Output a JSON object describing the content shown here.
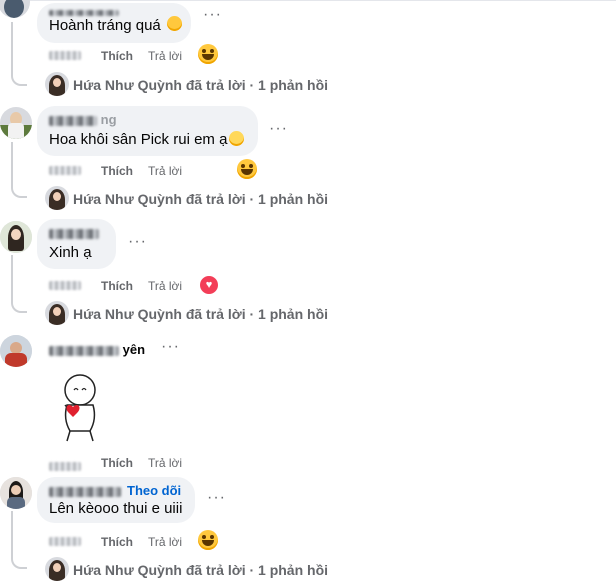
{
  "comments": [
    {
      "text": "Hoành tráng quá",
      "emoji": "🥺",
      "reply_label": "Trả lời",
      "like_label": "Thích"
    },
    {
      "name_suffix": "ng",
      "text": "Hoa khôi sân Pick rui em ạ",
      "emoji": "😬",
      "reply_label": "Trả lời",
      "like_label": "Thích"
    },
    {
      "text": "Xinh ạ",
      "reply_label": "Trả lời",
      "like_label": "Thích"
    },
    {
      "name_suffix": "yên",
      "reply_label": "Trả lời",
      "like_label": "Thích"
    },
    {
      "follow_label": "Theo dõi",
      "text": "Lên kèooo thui e uiii",
      "reply_label": "Trả lời",
      "like_label": "Thích"
    }
  ],
  "reply_summary": "Hứa Như Quỳnh đã trả lời · 1 phản hồi",
  "more_dots": "···",
  "reactions": {
    "haha": "haha-emoji",
    "love": "love-heart-icon"
  },
  "colors": {
    "bubble": "#f0f2f5",
    "follow": "#0064d1",
    "meta": "#65676b",
    "love": "#f33e58"
  }
}
